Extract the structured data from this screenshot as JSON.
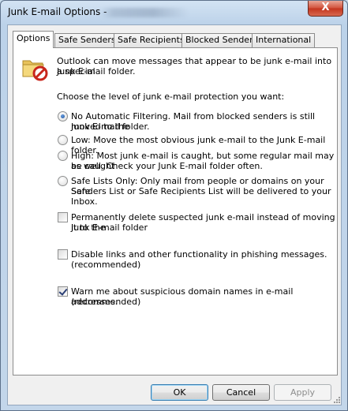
{
  "window": {
    "title": "Junk E-mail Options - ",
    "close_glyph": "X"
  },
  "tabs": [
    {
      "label": "Options",
      "active": true
    },
    {
      "label": "Safe Senders",
      "active": false
    },
    {
      "label": "Safe Recipients",
      "active": false
    },
    {
      "label": "Blocked Senders",
      "active": false
    },
    {
      "label": "International",
      "active": false
    }
  ],
  "intro": {
    "icon": "junk-folder-icon",
    "line1": "Outlook can move messages that appear to be junk e-mail into a special",
    "line2": "Junk E-mail folder."
  },
  "level_prompt": "Choose the level of junk e-mail protection you want:",
  "levels": [
    {
      "line1": "No Automatic Filtering. Mail from blocked senders is still moved to the",
      "line2": "Junk E-mail folder.",
      "selected": true
    },
    {
      "line1": "Low: Move the most obvious junk e-mail to the Junk E-mail folder.",
      "line2": "",
      "selected": false
    },
    {
      "line1": "High: Most junk e-mail is caught, but some regular mail may be caught",
      "line2": "as well. Check your Junk E-mail folder often.",
      "selected": false
    },
    {
      "line1": "Safe Lists Only: Only mail from people or domains on your Safe",
      "line2": "Senders List or Safe Recipients List will be delivered to your Inbox.",
      "selected": false
    }
  ],
  "checkboxes": [
    {
      "line1": "Permanently delete suspected junk e-mail instead of moving it to the",
      "line2": "Junk E-mail folder",
      "checked": false
    },
    {
      "line1": "Disable links and other functionality in phishing messages.",
      "line2": "(recommended)",
      "checked": false
    },
    {
      "line1": "Warn me about suspicious domain names in e-mail addresses.",
      "line2": "(recommended)",
      "checked": true
    }
  ],
  "buttons": {
    "ok": "OK",
    "cancel": "Cancel",
    "apply": "Apply"
  },
  "colors": {
    "accent": "#3c7fb1",
    "close": "#c3341d"
  }
}
